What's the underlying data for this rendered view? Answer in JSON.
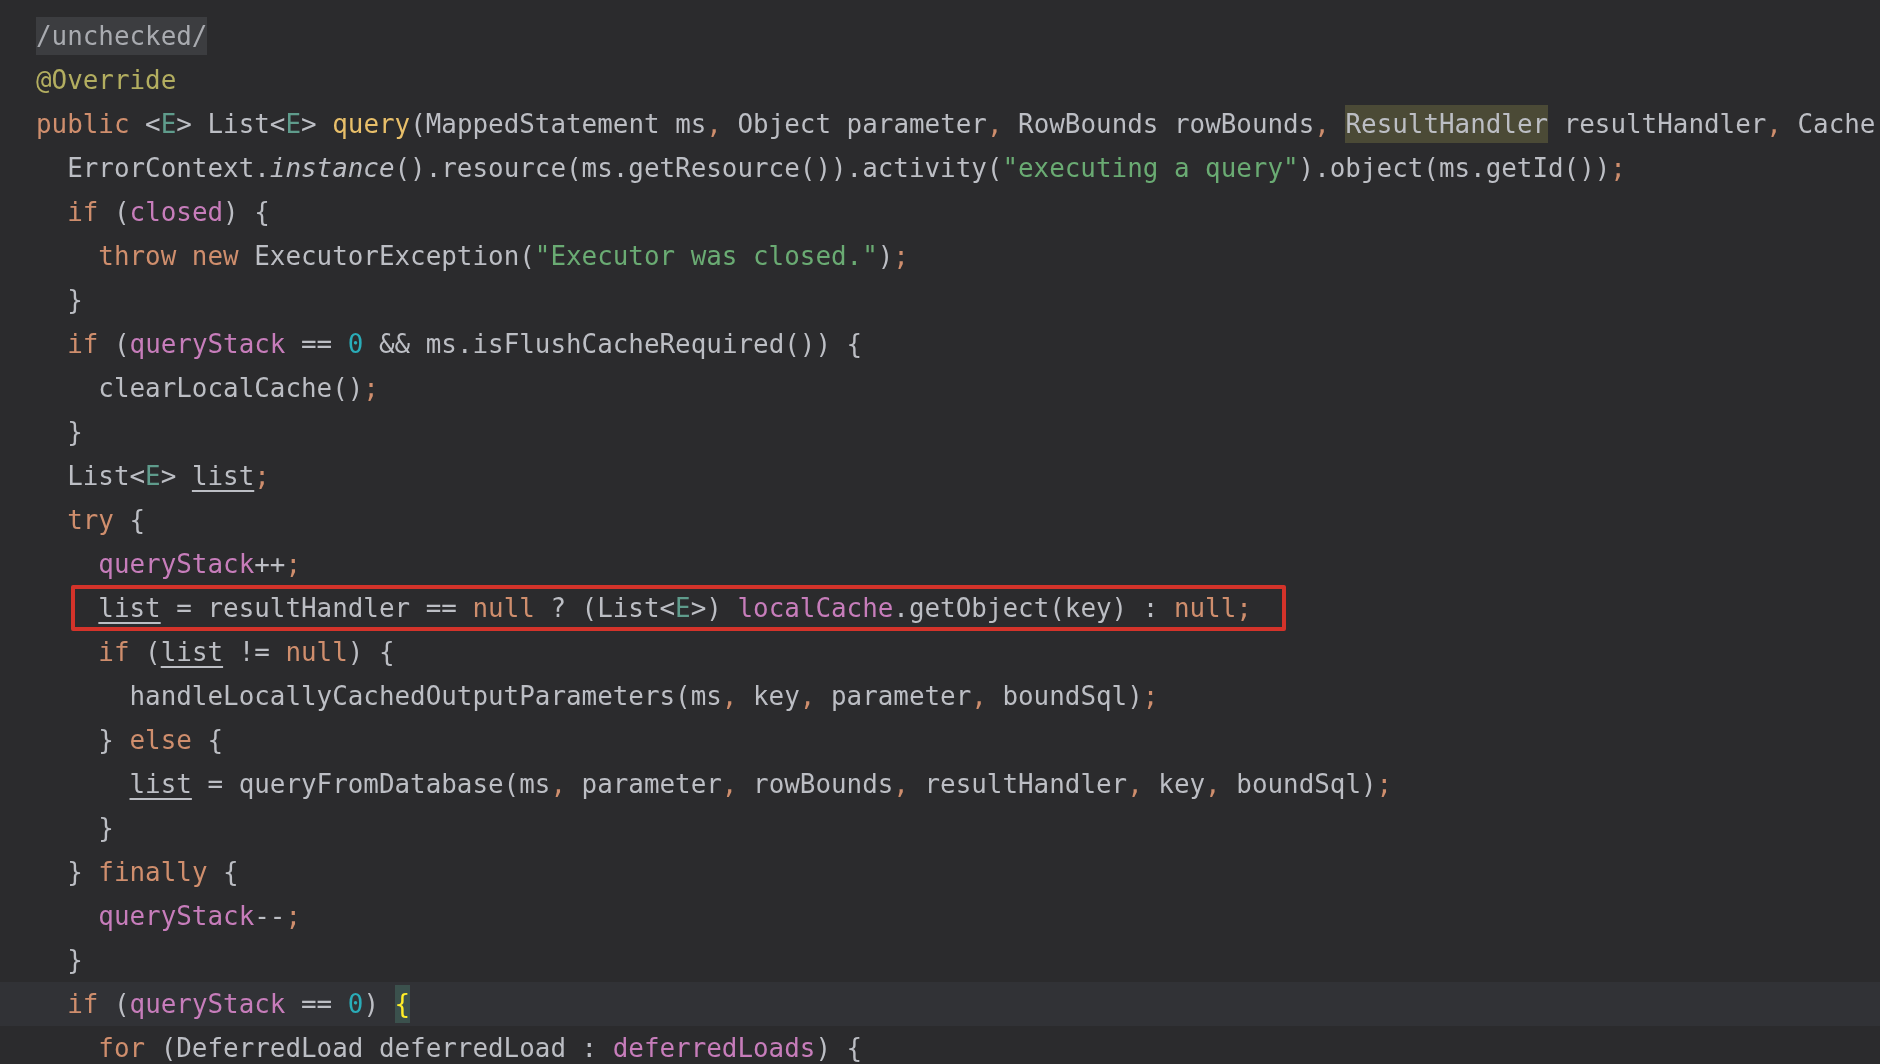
{
  "editor": {
    "lines": [
      {
        "tokens": [
          {
            "kind": "fold",
            "text": "/unchecked/"
          }
        ]
      },
      {
        "tokens": [
          {
            "kind": "annotation",
            "text": "@Override"
          }
        ]
      },
      {
        "tokens": [
          {
            "kind": "keyword",
            "text": "public"
          },
          {
            "kind": "plain",
            "text": " <"
          },
          {
            "kind": "typeparam",
            "text": "E"
          },
          {
            "kind": "plain",
            "text": "> List<"
          },
          {
            "kind": "typeparam",
            "text": "E"
          },
          {
            "kind": "plain",
            "text": "> "
          },
          {
            "kind": "method",
            "text": "query"
          },
          {
            "kind": "plain",
            "text": "(MappedStatement ms"
          },
          {
            "kind": "punct",
            "text": ","
          },
          {
            "kind": "plain",
            "text": " Object parameter"
          },
          {
            "kind": "punct",
            "text": ","
          },
          {
            "kind": "plain",
            "text": " RowBounds rowBounds"
          },
          {
            "kind": "punct",
            "text": ", "
          },
          {
            "kind": "usage",
            "text": "ResultHandler"
          },
          {
            "kind": "plain",
            "text": " resultHandler"
          },
          {
            "kind": "punct",
            "text": ","
          },
          {
            "kind": "plain",
            "text": " Cache"
          }
        ],
        "children": [
          {
            "tokens": [
              {
                "kind": "plain",
                "text": "ErrorContext."
              },
              {
                "kind": "static",
                "text": "instance"
              },
              {
                "kind": "plain",
                "text": "().resource(ms.getResource()).activity("
              },
              {
                "kind": "string",
                "text": "\"executing a query\""
              },
              {
                "kind": "plain",
                "text": ").object(ms.getId())"
              },
              {
                "kind": "punct",
                "text": ";"
              }
            ]
          },
          {
            "tokens": [
              {
                "kind": "keyword",
                "text": "if"
              },
              {
                "kind": "plain",
                "text": " ("
              },
              {
                "kind": "field",
                "text": "closed"
              },
              {
                "kind": "plain",
                "text": ") {"
              }
            ],
            "children": [
              {
                "tokens": [
                  {
                    "kind": "keyword",
                    "text": "throw new"
                  },
                  {
                    "kind": "plain",
                    "text": " ExecutorException("
                  },
                  {
                    "kind": "string",
                    "text": "\"Executor was closed.\""
                  },
                  {
                    "kind": "plain",
                    "text": ")"
                  },
                  {
                    "kind": "punct",
                    "text": ";"
                  }
                ]
              }
            ]
          },
          {
            "tokens": [
              {
                "kind": "plain",
                "text": "}"
              }
            ]
          },
          {
            "tokens": [
              {
                "kind": "keyword",
                "text": "if"
              },
              {
                "kind": "plain",
                "text": " ("
              },
              {
                "kind": "field",
                "text": "queryStack"
              },
              {
                "kind": "plain",
                "text": " == "
              },
              {
                "kind": "number",
                "text": "0"
              },
              {
                "kind": "plain",
                "text": " && ms.isFlushCacheRequired()) {"
              }
            ],
            "children": [
              {
                "tokens": [
                  {
                    "kind": "plain",
                    "text": "clearLocalCache()"
                  },
                  {
                    "kind": "punct",
                    "text": ";"
                  }
                ]
              }
            ]
          },
          {
            "tokens": [
              {
                "kind": "plain",
                "text": "}"
              }
            ]
          },
          {
            "tokens": [
              {
                "kind": "plain",
                "text": "List<"
              },
              {
                "kind": "typeparam",
                "text": "E"
              },
              {
                "kind": "plain",
                "text": "> "
              },
              {
                "kind": "reassigned",
                "text": "list"
              },
              {
                "kind": "punct",
                "text": ";"
              }
            ]
          },
          {
            "tokens": [
              {
                "kind": "keyword",
                "text": "try"
              },
              {
                "kind": "plain",
                "text": " {"
              }
            ],
            "children": [
              {
                "tokens": [
                  {
                    "kind": "field",
                    "text": "queryStack"
                  },
                  {
                    "kind": "plain",
                    "text": "++"
                  },
                  {
                    "kind": "punct",
                    "text": ";"
                  }
                ]
              },
              {
                "boxed": true,
                "tokens": [
                  {
                    "kind": "reassigned",
                    "text": "list"
                  },
                  {
                    "kind": "plain",
                    "text": " = resultHandler == "
                  },
                  {
                    "kind": "keyword",
                    "text": "null"
                  },
                  {
                    "kind": "plain",
                    "text": " ? (List<"
                  },
                  {
                    "kind": "typeparam",
                    "text": "E"
                  },
                  {
                    "kind": "plain",
                    "text": ">) "
                  },
                  {
                    "kind": "field",
                    "text": "localCache"
                  },
                  {
                    "kind": "plain",
                    "text": ".getObject(key) : "
                  },
                  {
                    "kind": "keyword",
                    "text": "null"
                  },
                  {
                    "kind": "punct",
                    "text": ";"
                  }
                ]
              },
              {
                "tokens": [
                  {
                    "kind": "keyword",
                    "text": "if"
                  },
                  {
                    "kind": "plain",
                    "text": " ("
                  },
                  {
                    "kind": "reassigned",
                    "text": "list"
                  },
                  {
                    "kind": "plain",
                    "text": " != "
                  },
                  {
                    "kind": "keyword",
                    "text": "null"
                  },
                  {
                    "kind": "plain",
                    "text": ") {"
                  }
                ],
                "children": [
                  {
                    "tokens": [
                      {
                        "kind": "plain",
                        "text": "handleLocallyCachedOutputParameters(ms"
                      },
                      {
                        "kind": "punct",
                        "text": ","
                      },
                      {
                        "kind": "plain",
                        "text": " key"
                      },
                      {
                        "kind": "punct",
                        "text": ","
                      },
                      {
                        "kind": "plain",
                        "text": " parameter"
                      },
                      {
                        "kind": "punct",
                        "text": ","
                      },
                      {
                        "kind": "plain",
                        "text": " boundSql)"
                      },
                      {
                        "kind": "punct",
                        "text": ";"
                      }
                    ]
                  }
                ]
              },
              {
                "tokens": [
                  {
                    "kind": "plain",
                    "text": "} "
                  },
                  {
                    "kind": "keyword",
                    "text": "else"
                  },
                  {
                    "kind": "plain",
                    "text": " {"
                  }
                ],
                "children": [
                  {
                    "tokens": [
                      {
                        "kind": "reassigned",
                        "text": "list"
                      },
                      {
                        "kind": "plain",
                        "text": " = queryFromDatabase(ms"
                      },
                      {
                        "kind": "punct",
                        "text": ","
                      },
                      {
                        "kind": "plain",
                        "text": " parameter"
                      },
                      {
                        "kind": "punct",
                        "text": ","
                      },
                      {
                        "kind": "plain",
                        "text": " rowBounds"
                      },
                      {
                        "kind": "punct",
                        "text": ","
                      },
                      {
                        "kind": "plain",
                        "text": " resultHandler"
                      },
                      {
                        "kind": "punct",
                        "text": ","
                      },
                      {
                        "kind": "plain",
                        "text": " key"
                      },
                      {
                        "kind": "punct",
                        "text": ","
                      },
                      {
                        "kind": "plain",
                        "text": " boundSql)"
                      },
                      {
                        "kind": "punct",
                        "text": ";"
                      }
                    ]
                  }
                ]
              },
              {
                "tokens": [
                  {
                    "kind": "plain",
                    "text": "}"
                  }
                ]
              }
            ]
          },
          {
            "tokens": [
              {
                "kind": "plain",
                "text": "} "
              },
              {
                "kind": "keyword",
                "text": "finally"
              },
              {
                "kind": "plain",
                "text": " {"
              }
            ],
            "children": [
              {
                "tokens": [
                  {
                    "kind": "field",
                    "text": "queryStack"
                  },
                  {
                    "kind": "plain",
                    "text": "--"
                  },
                  {
                    "kind": "punct",
                    "text": ";"
                  }
                ]
              }
            ]
          },
          {
            "tokens": [
              {
                "kind": "plain",
                "text": "}"
              }
            ]
          },
          {
            "current": true,
            "tokens": [
              {
                "kind": "keyword",
                "text": "if"
              },
              {
                "kind": "plain",
                "text": " ("
              },
              {
                "kind": "field",
                "text": "queryStack"
              },
              {
                "kind": "plain",
                "text": " == "
              },
              {
                "kind": "number",
                "text": "0"
              },
              {
                "kind": "plain",
                "text": ") "
              },
              {
                "kind": "bracket",
                "text": "{"
              }
            ],
            "children": [
              {
                "tokens": [
                  {
                    "kind": "keyword",
                    "text": "for"
                  },
                  {
                    "kind": "plain",
                    "text": " (DeferredLoad deferredLoad : "
                  },
                  {
                    "kind": "field",
                    "text": "deferredLoads"
                  },
                  {
                    "kind": "plain",
                    "text": ") {"
                  }
                ]
              }
            ]
          }
        ]
      }
    ]
  }
}
